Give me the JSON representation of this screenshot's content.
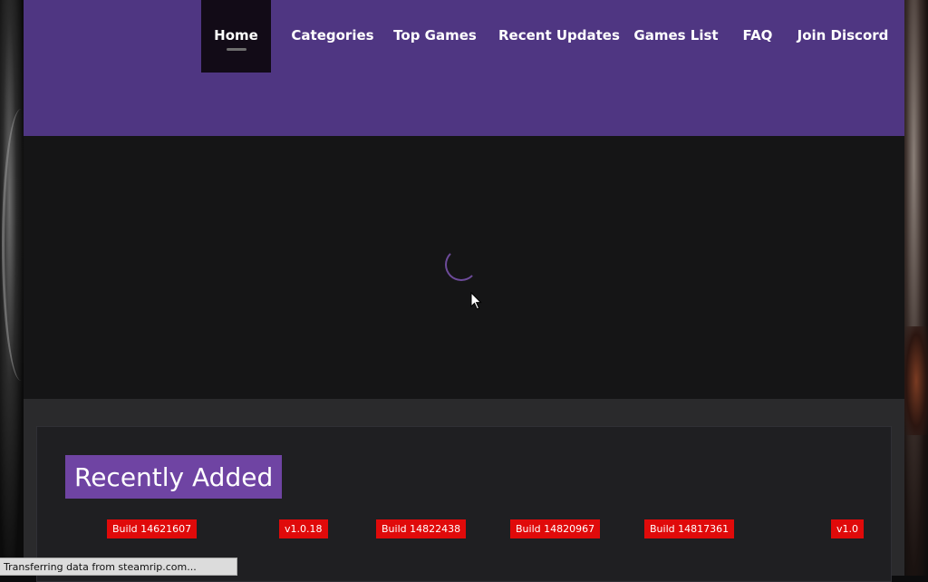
{
  "nav": {
    "items": [
      {
        "label": "Home",
        "active": true
      },
      {
        "label": "Categories"
      },
      {
        "label": "Top Games"
      },
      {
        "label": "Recent Updates"
      },
      {
        "label": "Games List"
      },
      {
        "label": "FAQ"
      },
      {
        "label": "Join Discord"
      }
    ]
  },
  "hero": {
    "loading_icon": "spinner-icon"
  },
  "recent": {
    "title": "Recently Added",
    "badges": [
      "Build 14621607",
      "v1.0.18",
      "Build 14822438",
      "Build 14820967",
      "Build 14817361",
      "v1.0"
    ]
  },
  "status_bar": {
    "text": "Transferring data from steamrip.com..."
  },
  "colors": {
    "header_bg": "#4f3682",
    "active_nav_bg": "#120b17",
    "hero_bg": "#151516",
    "title_bg": "#6f44a3",
    "badge_bg": "#e00a0a"
  }
}
